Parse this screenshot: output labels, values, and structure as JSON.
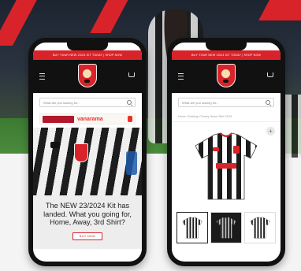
{
  "left_phone": {
    "promo_bar": "BUY YOUR NEW 23/24 KIT TODAY | SHOP NOW",
    "search_placeholder": "What are you looking for...",
    "sponsor": {
      "left_badge": "CHORLEY FC",
      "brand": "vanarama"
    },
    "promo_headline": "The NEW 23/2024 Kit has landed. What you going for, Home, Away, 3rd Shirt?",
    "buy_button": "BUY NOW"
  },
  "right_phone": {
    "promo_bar": "BUY YOUR NEW 23/24 KIT TODAY | SHOP NOW",
    "search_placeholder": "What are you looking for...",
    "breadcrumb": [
      "Home",
      "Clothing",
      "Chorley Home Shirt 23/24"
    ],
    "zoom_label": "+"
  },
  "colors": {
    "brand_red": "#d8232a",
    "header_black": "#111111"
  }
}
